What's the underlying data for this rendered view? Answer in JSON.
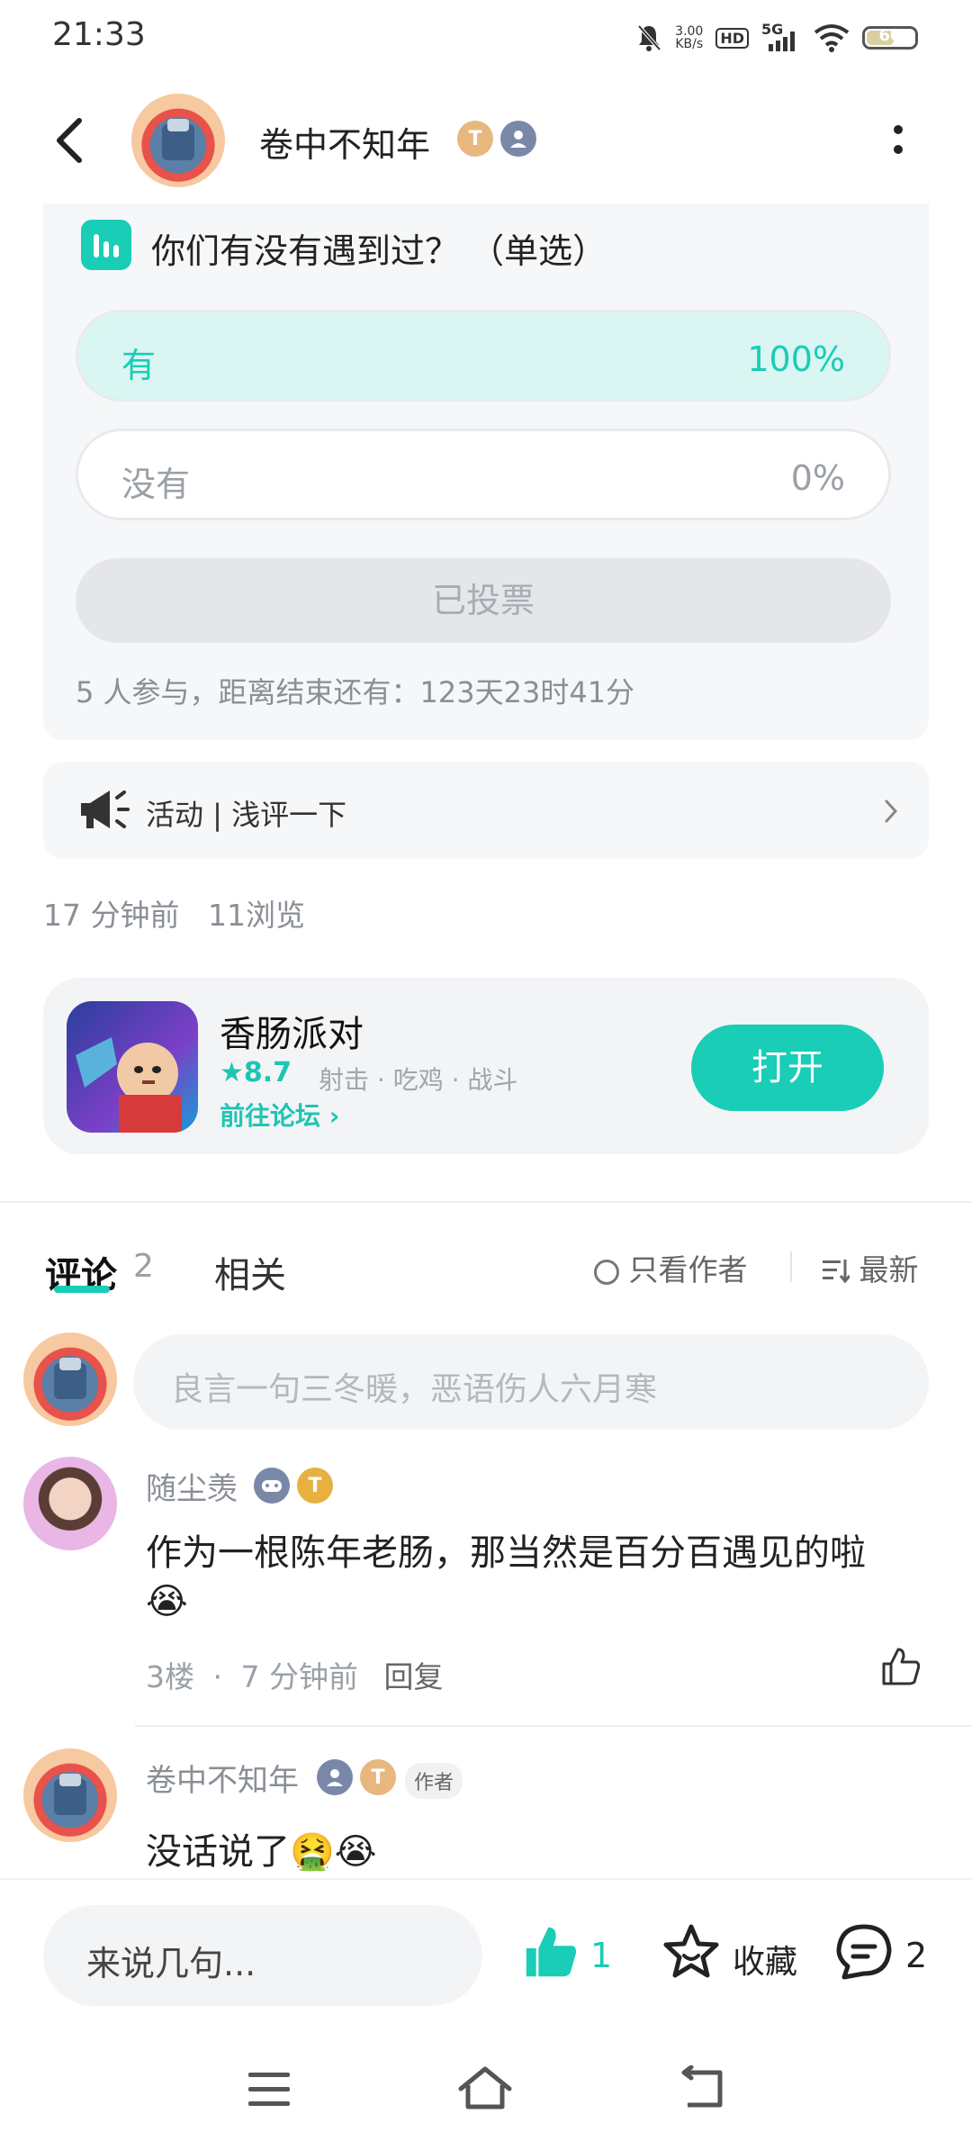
{
  "status_bar": {
    "time": "21:33",
    "net_speed_value": "3.00",
    "net_speed_unit": "KB/s",
    "hd": "HD",
    "network": "5G",
    "battery": "60",
    "battery_level_pct": 60
  },
  "header": {
    "title": "卷中不知年",
    "icons": [
      "back-icon",
      "more-icon"
    ]
  },
  "poll": {
    "question": "你们有没有遇到过？ （单选）",
    "options": [
      {
        "label": "有",
        "percent": "100%"
      },
      {
        "label": "没有",
        "percent": "0%"
      }
    ],
    "voted_label": "已投票",
    "info": "5 人参与，距离结束还有：123天23时41分"
  },
  "activity": {
    "label": "活动 | 浅评一下"
  },
  "post_meta": {
    "time": "17 分钟前",
    "views": "11浏览"
  },
  "game": {
    "name": "香肠派对",
    "rating": "8.7",
    "tags": "射击 · 吃鸡 · 战斗",
    "forum_link": "前往论坛",
    "open_button": "打开"
  },
  "tabs": {
    "comments_label": "评论",
    "comments_count": "2",
    "related_label": "相关",
    "author_only_label": "只看作者",
    "sort_label": "最新"
  },
  "comment_input": {
    "placeholder": "良言一句三冬暖，恶语伤人六月寒"
  },
  "comments": [
    {
      "user": "随尘羡",
      "text": "作为一根陈年老肠，那当然是百分百遇见的啦",
      "emoji": "😭",
      "floor": "3楼",
      "time": "7 分钟前",
      "reply": "回复"
    },
    {
      "user": "卷中不知年",
      "author_tag": "作者",
      "text": "没话说了",
      "emoji": "🤮😭"
    }
  ],
  "bottom_bar": {
    "placeholder": "来说几句...",
    "like_count": "1",
    "favorite_label": "收藏",
    "comment_count": "2"
  },
  "colors": {
    "accent": "#19cdb6",
    "card_bg": "#f6f7f8",
    "poll_selected": "#d9f6f2"
  }
}
